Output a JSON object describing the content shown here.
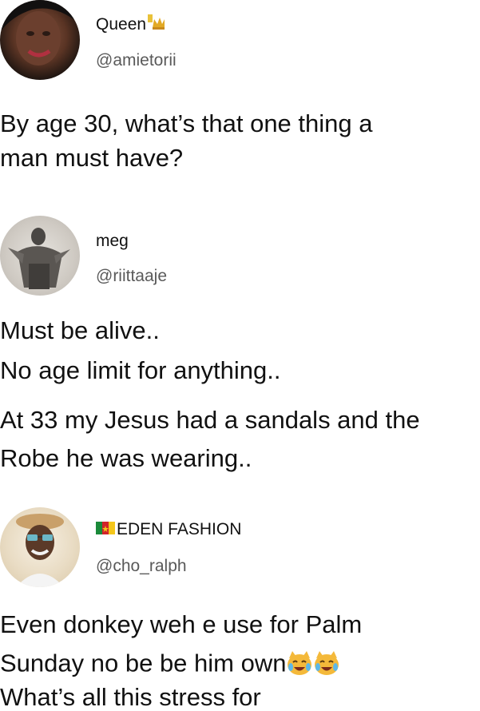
{
  "tweets": [
    {
      "name": "Queen",
      "name_emoji": "crown-emoji",
      "handle": "@amietorii",
      "lines": [
        "By age 30, what’s that one thing a",
        "man must have?"
      ]
    },
    {
      "name": "meg",
      "handle": "@riittaaje",
      "lines": [
        "Must be alive..",
        "No age limit for anything..",
        "At 33 my Jesus had a sandals and the",
        "Robe he was wearing.."
      ]
    },
    {
      "name": "EDEN FASHION",
      "name_flag": "cameroon-flag-emoji",
      "handle": "@cho_ralph",
      "lines": [
        "Even donkey weh e use for Palm",
        "Sunday no be be him own",
        "What’s all this stress for"
      ],
      "line_emojis": [
        "laughing-crying-cat-emoji",
        "laughing-crying-cat-emoji"
      ]
    }
  ]
}
